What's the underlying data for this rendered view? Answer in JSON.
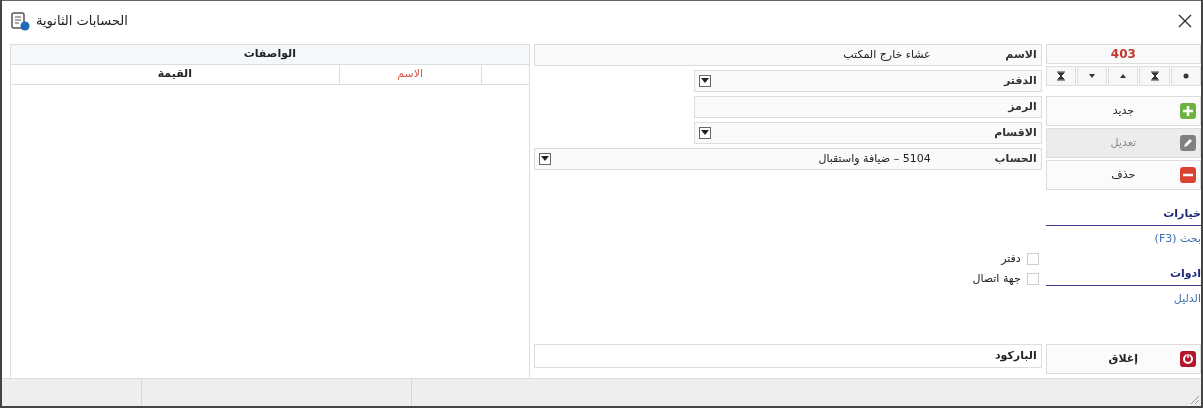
{
  "window": {
    "title": "الحسابات الثانوية"
  },
  "record_counter": "403",
  "actions": [
    {
      "label": "جديد",
      "kind": "new",
      "disabled": false
    },
    {
      "label": "تعديل",
      "kind": "edit",
      "disabled": true
    },
    {
      "label": "حذف",
      "kind": "delete",
      "disabled": false
    }
  ],
  "sections": [
    {
      "heading": "خيارات",
      "links": [
        "بحث (F3)"
      ]
    },
    {
      "heading": "ادوات",
      "links": [
        "الدليل"
      ]
    }
  ],
  "close_button": {
    "label": "إغلاق"
  },
  "form": {
    "fields": [
      {
        "label": "الاسم",
        "value": "عشاء خارج المكتب",
        "kind": "wide-text"
      },
      {
        "label": "الدفتر",
        "kind": "dropdown"
      },
      {
        "label": "الرمز",
        "kind": "text"
      },
      {
        "label": "الاقسام",
        "kind": "dropdown"
      },
      {
        "label": "الحساب",
        "value": "5104 – ضيافة واستقبال",
        "kind": "wide-dropdown"
      }
    ],
    "checkboxes": [
      {
        "label": "دفتر",
        "checked": false
      },
      {
        "label": "جهة اتصال",
        "checked": false
      }
    ],
    "barcode": {
      "label": "الباركود"
    }
  },
  "grid": {
    "header": "الواصفات",
    "columns": [
      {
        "label": "الاسم",
        "kind": "key"
      },
      {
        "label": "القيمة",
        "kind": "value"
      }
    ]
  }
}
